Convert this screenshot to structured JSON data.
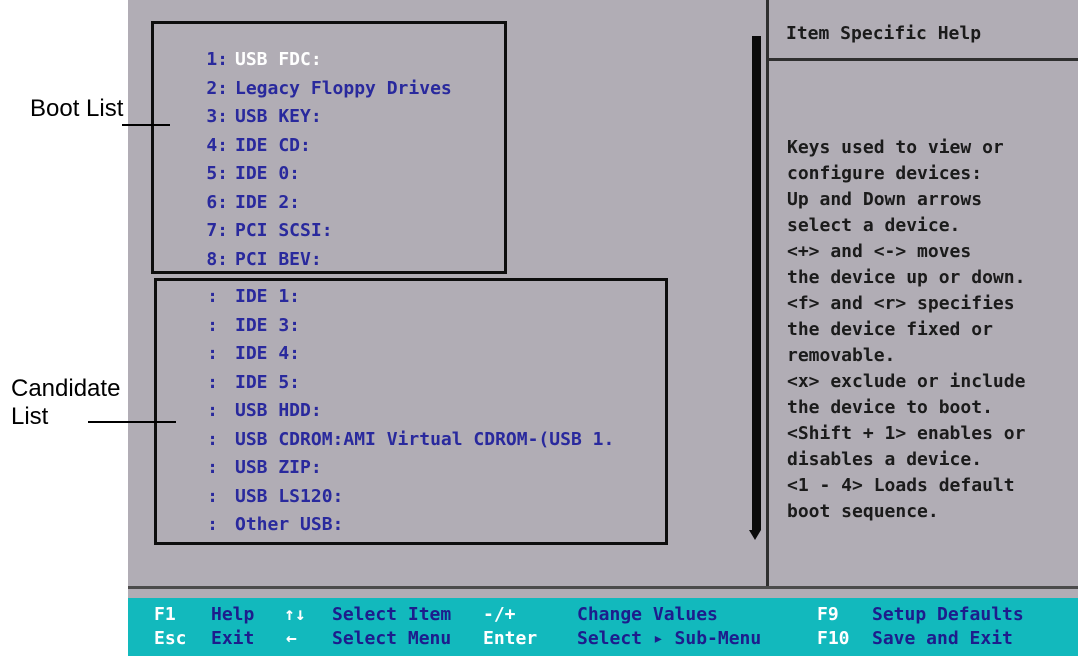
{
  "screen": {
    "boot_list": [
      {
        "number": "1:",
        "label": "USB FDC:"
      },
      {
        "number": "2:",
        "label": "Legacy Floppy Drives"
      },
      {
        "number": "3:",
        "label": "USB KEY:"
      },
      {
        "number": "4:",
        "label": "IDE CD:"
      },
      {
        "number": "5:",
        "label": "IDE 0:"
      },
      {
        "number": "6:",
        "label": "IDE 2:"
      },
      {
        "number": "7:",
        "label": "PCI SCSI:"
      },
      {
        "number": "8:",
        "label": "PCI BEV:"
      }
    ],
    "candidate_list": [
      {
        "number": ":",
        "label": "IDE 1:"
      },
      {
        "number": ":",
        "label": "IDE 3:"
      },
      {
        "number": ":",
        "label": "IDE 4:"
      },
      {
        "number": ":",
        "label": "IDE 5:"
      },
      {
        "number": ":",
        "label": "USB HDD:"
      },
      {
        "number": ":",
        "label": "USB CDROM:AMI Virtual CDROM-(USB 1."
      },
      {
        "number": ":",
        "label": "USB ZIP:"
      },
      {
        "number": ":",
        "label": "USB LS120:"
      },
      {
        "number": ":",
        "label": "Other USB:"
      }
    ]
  },
  "help": {
    "title": "Item Specific Help",
    "lines": [
      "Keys used to view or",
      "configure devices:",
      "Up and Down arrows",
      "select a device.",
      "<+> and <-> moves",
      "the device up or down.",
      "<f> and <r> specifies",
      "the device fixed or",
      "removable.",
      "<x> exclude or include",
      "the device to boot.",
      "<Shift + 1> enables or",
      "disables a device.",
      "<1 - 4> Loads default",
      "boot sequence."
    ]
  },
  "footer": {
    "row1": [
      {
        "key": "F1",
        "desc": "Help"
      },
      {
        "key": "↑↓",
        "desc": "Select Item"
      },
      {
        "key": "-/+",
        "desc": "Change Values"
      },
      {
        "key": "F9",
        "desc": "Setup Defaults"
      }
    ],
    "row2": [
      {
        "key": "Esc",
        "desc": "Exit"
      },
      {
        "key": "←",
        "desc": "Select Menu"
      },
      {
        "key": "Enter",
        "desc": "Select ▸ Sub-Menu"
      },
      {
        "key": "F10",
        "desc": "Save and Exit"
      }
    ]
  },
  "annotations": {
    "boot_list": "Boot List",
    "candidate_list": "Candidate\nList"
  },
  "colors": {
    "screen_bg": "#b1adb5",
    "text_blue": "#29299d",
    "footer_bg": "#12b9bd",
    "highlight": "#ffffff"
  },
  "icons": {
    "scroll_down": "down-arrow-icon"
  }
}
